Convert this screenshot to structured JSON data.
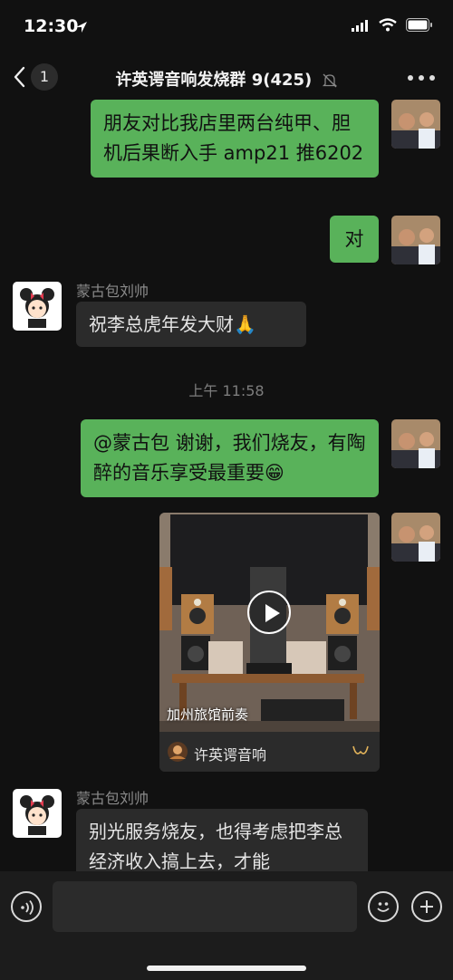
{
  "status_bar": {
    "time": "12:30"
  },
  "header": {
    "unread_count": "1",
    "title": "许英谔音响发烧群 9(425)"
  },
  "messages": [
    {
      "direction": "out",
      "text": "朋友对比我店里两台纯甲、胆机后果断入手 amp21 推6202"
    },
    {
      "direction": "out",
      "text": "对"
    },
    {
      "direction": "in",
      "sender": "蒙古包刘帅",
      "text": "祝李总虎年发大财🙏"
    },
    {
      "timestamp": "上午 11:58"
    },
    {
      "direction": "out",
      "text": "@蒙古包 谢谢，我们烧友，有陶醉的音乐享受最重要😁"
    },
    {
      "direction": "out",
      "type": "video",
      "caption": "加州旅馆前奏",
      "channel": "许英谔音响"
    },
    {
      "direction": "in",
      "sender": "蒙古包刘帅",
      "text": "别光服务烧友，也得考虑把李总经济收入搞上去，才能"
    }
  ]
}
